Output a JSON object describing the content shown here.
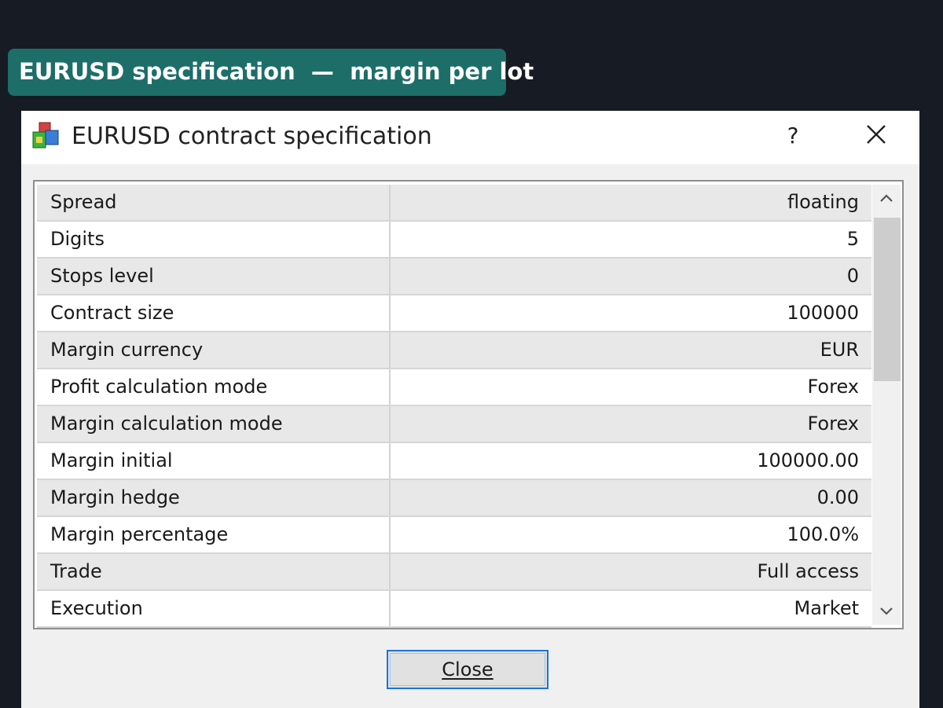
{
  "banner": {
    "text": "EURUSD specification  —  margin per lot"
  },
  "dialog": {
    "title": "EURUSD contract specification",
    "icon": "mt-symbol-icon",
    "help_label": "?",
    "close_x_icon": "close-icon"
  },
  "specs": [
    {
      "label": "Spread",
      "value": "floating"
    },
    {
      "label": "Digits",
      "value": "5"
    },
    {
      "label": "Stops level",
      "value": "0"
    },
    {
      "label": "Contract size",
      "value": "100000"
    },
    {
      "label": "Margin currency",
      "value": "EUR"
    },
    {
      "label": "Profit calculation mode",
      "value": "Forex"
    },
    {
      "label": "Margin calculation mode",
      "value": "Forex"
    },
    {
      "label": "Margin initial",
      "value": "100000.00"
    },
    {
      "label": "Margin hedge",
      "value": "0.00"
    },
    {
      "label": "Margin percentage",
      "value": "100.0%"
    },
    {
      "label": "Trade",
      "value": "Full access"
    },
    {
      "label": "Execution",
      "value": "Market"
    }
  ],
  "footer": {
    "close_label": "Close"
  },
  "colors": {
    "banner": "#1d6e68",
    "background": "#161b24",
    "focus_border": "#1a73d9"
  }
}
